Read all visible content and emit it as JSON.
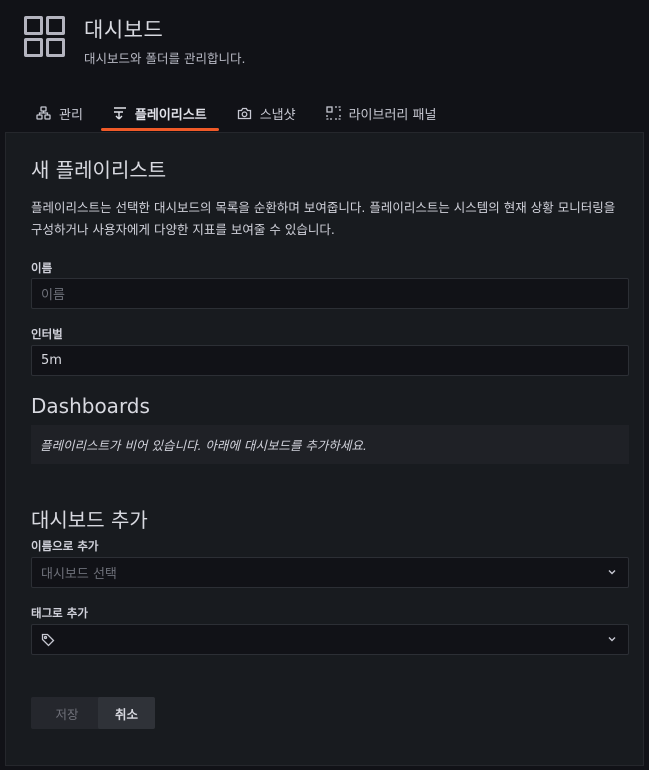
{
  "header": {
    "title": "대시보드",
    "subtitle": "대시보드와 폴더를 관리합니다.",
    "icon": "dashboard-grid-icon"
  },
  "tabs": [
    {
      "label": "관리",
      "icon": "sitemap-icon",
      "active": false
    },
    {
      "label": "플레이리스트",
      "icon": "playlist-icon",
      "active": true
    },
    {
      "label": "스냅샷",
      "icon": "camera-icon",
      "active": false
    },
    {
      "label": "라이브러리 패널",
      "icon": "library-panel-icon",
      "active": false
    }
  ],
  "form": {
    "title": "새 플레이리스트",
    "description": "플레이리스트는 선택한 대시보드의 목록을 순환하며 보여줍니다. 플레이리스트는 시스템의 현재 상황 모니터링을 구성하거나 사용자에게 다양한 지표를 보여줄 수 있습니다.",
    "name_label": "이름",
    "name_placeholder": "이름",
    "interval_label": "인터벌",
    "interval_value": "5m",
    "dashboards_title": "Dashboards",
    "empty_message": "플레이리스트가 비어 있습니다. 아래에 대시보드를 추가하세요.",
    "add_title": "대시보드 추가",
    "add_by_name_label": "이름으로 추가",
    "add_by_name_placeholder": "대시보드 선택",
    "add_by_tag_label": "태그로 추가",
    "save_label": "저장",
    "cancel_label": "취소"
  },
  "colors": {
    "accent": "#f05a28",
    "background": "#111217",
    "panel": "#181b1f"
  }
}
